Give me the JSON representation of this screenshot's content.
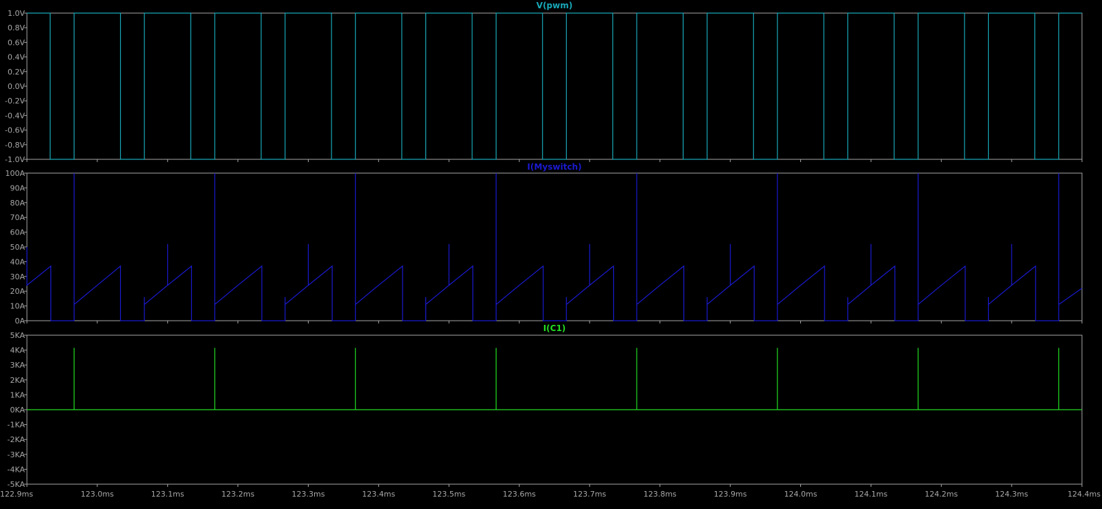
{
  "x_axis": {
    "ticks": [
      "122.9ms",
      "123.0ms",
      "123.1ms",
      "123.2ms",
      "123.3ms",
      "123.4ms",
      "123.5ms",
      "123.6ms",
      "123.7ms",
      "123.8ms",
      "123.9ms",
      "124.0ms",
      "124.1ms",
      "124.2ms",
      "124.3ms",
      "124.4ms"
    ]
  },
  "chart_data": [
    {
      "type": "line",
      "title": "V(pwm)",
      "color": "#18a8b8",
      "xlim": [
        122.9,
        124.4
      ],
      "ylim": [
        -1.0,
        1.0
      ],
      "grid": false,
      "y_ticks": [
        "1.0V",
        "0.8V",
        "0.6V",
        "0.4V",
        "0.2V",
        "0.0V",
        "-0.2V",
        "-0.4V",
        "-0.6V",
        "-0.8V",
        "-1.0V"
      ],
      "series": [
        {
          "name": "V(pwm)",
          "pulses_ms": [
            [
              122.9,
              123.1
            ],
            [
              122.968,
              123.1
            ],
            [
              123.167,
              123.2
            ],
            [
              123.267,
              123.2
            ]
          ],
          "x": [
            122.9,
            122.933,
            122.933,
            122.967,
            122.967,
            123.033,
            123.033,
            123.067,
            123.067,
            123.133,
            123.133,
            123.167,
            123.167,
            123.233,
            123.233,
            123.267,
            123.267,
            123.333,
            123.333,
            123.367,
            123.367,
            123.433,
            123.433,
            123.467,
            123.467,
            123.533,
            123.533,
            123.567,
            123.567,
            123.633,
            123.633,
            123.667,
            123.667,
            123.733,
            123.733,
            123.767,
            123.767,
            123.833,
            123.833,
            123.867,
            123.867,
            123.933,
            123.933,
            123.967,
            123.967,
            124.033,
            124.033,
            124.067,
            124.067,
            124.133,
            124.133,
            124.167,
            124.167,
            124.233,
            124.233,
            124.267,
            124.267,
            124.333,
            124.333,
            124.367,
            124.367,
            124.4
          ],
          "y": [
            1,
            1,
            -1,
            -1,
            1,
            1,
            -1,
            -1,
            1,
            1,
            -1,
            -1,
            1,
            1,
            -1,
            -1,
            1,
            1,
            -1,
            -1,
            1,
            1,
            -1,
            -1,
            1,
            1,
            -1,
            -1,
            1,
            1,
            -1,
            -1,
            1,
            1,
            -1,
            -1,
            1,
            1,
            -1,
            -1,
            1,
            1,
            -1,
            -1,
            1,
            1,
            -1,
            -1,
            1,
            1,
            -1,
            -1,
            1,
            1,
            -1,
            -1,
            1,
            1,
            -1,
            -1,
            1,
            1
          ]
        }
      ]
    },
    {
      "type": "line",
      "title": "I(Myswitch)",
      "color": "#1a1ad0",
      "xlim": [
        122.9,
        124.4
      ],
      "ylim": [
        0,
        100
      ],
      "grid": false,
      "y_ticks": [
        "100A",
        "90A",
        "80A",
        "70A",
        "60A",
        "50A",
        "40A",
        "30A",
        "20A",
        "10A",
        "0A"
      ],
      "series": [
        {
          "name": "I(Myswitch)",
          "x": [
            122.9,
            122.9,
            122.9,
            122.934,
            122.934,
            122.967,
            122.967,
            122.967,
            123.0,
            123.033,
            123.033,
            123.067,
            123.067,
            123.067,
            123.1,
            123.1,
            123.1,
            123.134,
            123.134,
            123.167,
            123.167,
            123.167,
            123.2,
            123.234,
            123.234,
            123.267,
            123.267,
            123.267,
            123.3,
            123.3,
            123.3,
            123.334,
            123.334,
            123.367,
            123.367,
            123.367,
            123.4,
            123.434,
            123.434,
            123.467,
            123.467,
            123.467,
            123.5,
            123.5,
            123.5,
            123.534,
            123.534,
            123.567,
            123.567,
            123.567,
            123.6,
            123.634,
            123.634,
            123.667,
            123.667,
            123.667,
            123.7,
            123.7,
            123.7,
            123.734,
            123.734,
            123.767,
            123.767,
            123.767,
            123.8,
            123.834,
            123.834,
            123.867,
            123.867,
            123.867,
            123.9,
            123.9,
            123.9,
            123.934,
            123.934,
            123.967,
            123.967,
            123.967,
            124.0,
            124.034,
            124.034,
            124.067,
            124.067,
            124.067,
            124.1,
            124.1,
            124.1,
            124.134,
            124.134,
            124.167,
            124.167,
            124.167,
            124.2,
            124.234,
            124.234,
            124.267,
            124.267,
            124.267,
            124.3,
            124.3,
            124.3,
            124.334,
            124.334,
            124.367,
            124.367,
            124.367,
            124.4
          ],
          "y": [
            50,
            24,
            24,
            37,
            0,
            0,
            100,
            11,
            24,
            37,
            0,
            0,
            16,
            11,
            24,
            52,
            24,
            37,
            0,
            0,
            100,
            11,
            24,
            37,
            0,
            0,
            16,
            11,
            24,
            52,
            24,
            37,
            0,
            0,
            100,
            11,
            24,
            37,
            0,
            0,
            16,
            11,
            24,
            52,
            24,
            37,
            0,
            0,
            100,
            11,
            24,
            37,
            0,
            0,
            16,
            11,
            24,
            52,
            24,
            37,
            0,
            0,
            100,
            11,
            24,
            37,
            0,
            0,
            16,
            11,
            24,
            52,
            24,
            37,
            0,
            0,
            100,
            11,
            24,
            37,
            0,
            0,
            16,
            11,
            24,
            52,
            24,
            37,
            0,
            0,
            100,
            11,
            24,
            37,
            0,
            0,
            16,
            11,
            24,
            52,
            24,
            37,
            0,
            0,
            100,
            11,
            22
          ]
        }
      ]
    },
    {
      "type": "line",
      "title": "I(C1)",
      "color": "#22dd22",
      "xlim": [
        122.9,
        124.4
      ],
      "ylim": [
        -5,
        5
      ],
      "grid": false,
      "y_ticks": [
        "5KA",
        "4KA",
        "3KA",
        "2KA",
        "1KA",
        "0KA",
        "-1KA",
        "-2KA",
        "-3KA",
        "-4KA",
        "-5KA"
      ],
      "series": [
        {
          "name": "I(C1)",
          "x": [
            122.9,
            122.967,
            122.967,
            122.967,
            123.167,
            123.167,
            123.167,
            123.367,
            123.367,
            123.367,
            123.567,
            123.567,
            123.567,
            123.767,
            123.767,
            123.767,
            123.967,
            123.967,
            123.967,
            124.167,
            124.167,
            124.167,
            124.367,
            124.367,
            124.367,
            124.4
          ],
          "y": [
            0,
            0,
            4.15,
            0,
            0,
            4.15,
            0,
            0,
            4.15,
            0,
            0,
            4.15,
            0,
            0,
            4.15,
            0,
            0,
            4.15,
            0,
            0,
            4.15,
            0,
            0,
            4.15,
            0,
            0
          ]
        }
      ]
    }
  ]
}
